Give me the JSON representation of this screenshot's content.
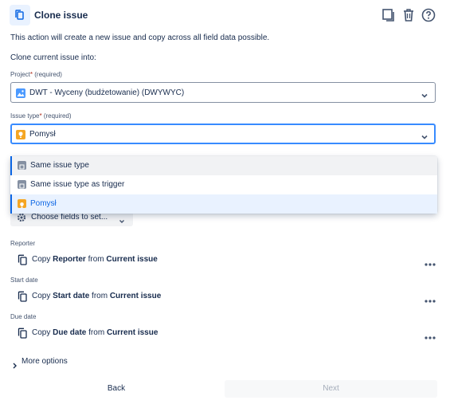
{
  "header": {
    "title": "Clone issue"
  },
  "description": "This action will create a new issue and copy across all field data possible.",
  "clone_into_label": "Clone current issue into:",
  "project": {
    "label": "Project",
    "required_mark": "*",
    "required_text": "(required)",
    "value": "DWT - Wyceny (budżetowanie) (DWYWYC)"
  },
  "issue_type": {
    "label": "Issue type",
    "required_mark": "*",
    "required_text": "(required)",
    "value": "Pomysł",
    "options": [
      {
        "label": "Same issue type",
        "icon": "generic-type-icon",
        "color": "#8590a2"
      },
      {
        "label": "Same issue type as trigger",
        "icon": "generic-type-icon",
        "color": "#8590a2"
      },
      {
        "label": "Pomysł",
        "icon": "lightbulb-icon",
        "color": "#f5a623"
      }
    ]
  },
  "choose_fields_button": "Choose fields to set...",
  "fields": [
    {
      "label": "Reporter",
      "prefix": "Copy",
      "field": "Reporter",
      "mid": "from",
      "source": "Current issue"
    },
    {
      "label": "Start date",
      "prefix": "Copy",
      "field": "Start date",
      "mid": "from",
      "source": "Current issue"
    },
    {
      "label": "Due date",
      "prefix": "Copy",
      "field": "Due date",
      "mid": "from",
      "source": "Current issue"
    }
  ],
  "more_options": "More options",
  "buttons": {
    "back": "Back",
    "next": "Next"
  },
  "colors": {
    "accent": "#0c66e4",
    "focus": "#388bff",
    "idea": "#f5a623",
    "required": "#ae2a19"
  }
}
